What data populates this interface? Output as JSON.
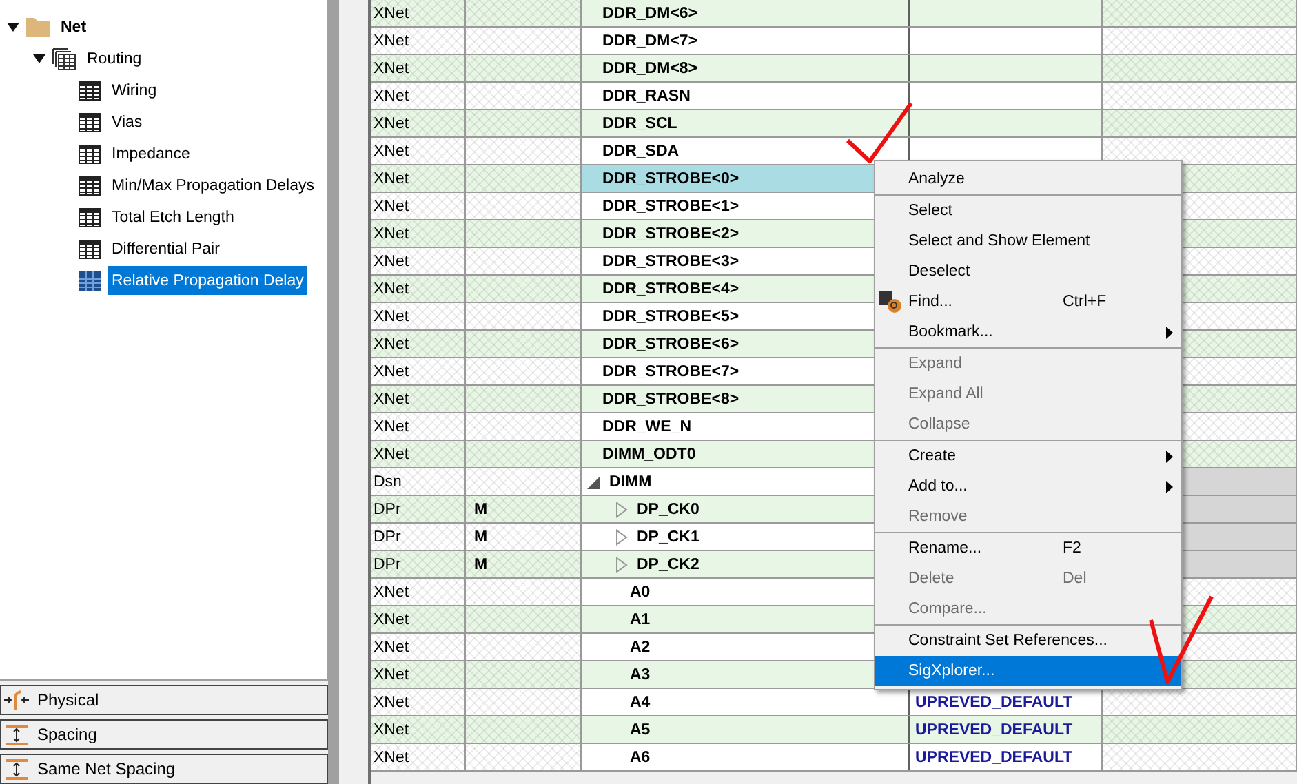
{
  "tree": [
    {
      "label": "Net",
      "expanded": true,
      "kind": "folder",
      "children": [
        {
          "label": "Routing",
          "expanded": true,
          "kind": "group",
          "children": [
            {
              "label": "Wiring",
              "kind": "sheet",
              "selected": false
            },
            {
              "label": "Vias",
              "kind": "sheet",
              "selected": false
            },
            {
              "label": "Impedance",
              "kind": "sheet",
              "selected": false
            },
            {
              "label": "Min/Max Propagation Delays",
              "kind": "sheet",
              "selected": false
            },
            {
              "label": "Total Etch Length",
              "kind": "sheet",
              "selected": false
            },
            {
              "label": "Differential Pair",
              "kind": "sheet",
              "selected": false
            },
            {
              "label": "Relative Propagation Delay",
              "kind": "sheet",
              "selected": true
            }
          ]
        }
      ]
    }
  ],
  "domains": [
    {
      "label": "Physical",
      "kind": "physical"
    },
    {
      "label": "Spacing",
      "kind": "spacing"
    },
    {
      "label": "Same Net Spacing",
      "kind": "spacing"
    }
  ],
  "table": {
    "rows": [
      {
        "column_1": "XNet",
        "column_3": "DDR_DM<6>",
        "selected": false
      },
      {
        "column_1": "XNet",
        "column_3": "DDR_DM<7>",
        "selected": false
      },
      {
        "column_1": "XNet",
        "column_3": "DDR_DM<8>",
        "selected": false
      },
      {
        "column_1": "XNet",
        "column_3": "DDR_RASN",
        "selected": false
      },
      {
        "column_1": "XNet",
        "column_3": "DDR_SCL",
        "selected": false
      },
      {
        "column_1": "XNet",
        "column_3": "DDR_SDA",
        "selected": false
      },
      {
        "column_1": "XNet",
        "column_3": "DDR_STROBE<0>",
        "selected": true
      },
      {
        "column_1": "XNet",
        "column_3": "DDR_STROBE<1>",
        "selected": false
      },
      {
        "column_1": "XNet",
        "column_3": "DDR_STROBE<2>",
        "selected": false
      },
      {
        "column_1": "XNet",
        "column_3": "DDR_STROBE<3>",
        "selected": false
      },
      {
        "column_1": "XNet",
        "column_3": "DDR_STROBE<4>",
        "selected": false
      },
      {
        "column_1": "XNet",
        "column_3": "DDR_STROBE<5>",
        "selected": false
      },
      {
        "column_1": "XNet",
        "column_3": "DDR_STROBE<6>",
        "selected": false
      },
      {
        "column_1": "XNet",
        "column_3": "DDR_STROBE<7>",
        "selected": false
      },
      {
        "column_1": "XNet",
        "column_3": "DDR_STROBE<8>",
        "selected": false
      },
      {
        "column_1": "XNet",
        "column_3": "DDR_WE_N",
        "selected": false
      },
      {
        "column_1": "XNet",
        "column_3": "DIMM_ODT0",
        "selected": false
      },
      {
        "column_1": "Dsn",
        "column_3": "DIMM",
        "selected": false,
        "expanded": true,
        "children": [
          {
            "column_1": "DPr",
            "column_2": "M",
            "column_3": "DP_CK0",
            "selected": false,
            "expanded": false
          },
          {
            "column_1": "DPr",
            "column_2": "M",
            "column_3": "DP_CK1",
            "selected": false,
            "expanded": false
          },
          {
            "column_1": "DPr",
            "column_2": "M",
            "column_3": "DP_CK2",
            "selected": false,
            "expanded": false
          },
          {
            "column_1": "XNet",
            "column_3": "A0",
            "selected": false
          },
          {
            "column_1": "XNet",
            "column_3": "A1",
            "selected": false
          },
          {
            "column_1": "XNet",
            "column_3": "A2",
            "selected": false
          },
          {
            "column_1": "XNet",
            "column_3": "A3",
            "selected": false
          },
          {
            "column_1": "XNet",
            "column_3": "A4",
            "column_4": "UPREVED_DEFAULT",
            "selected": false
          },
          {
            "column_1": "XNet",
            "column_3": "A5",
            "column_4": "UPREVED_DEFAULT",
            "selected": false
          },
          {
            "column_1": "XNet",
            "column_3": "A6",
            "column_4": "UPREVED_DEFAULT",
            "selected": false
          }
        ]
      }
    ]
  },
  "context_menu": [
    {
      "kind": "item",
      "label": "Analyze",
      "disabled": false,
      "highlighted": false
    },
    {
      "kind": "separator"
    },
    {
      "kind": "item",
      "label": "Select",
      "disabled": false,
      "highlighted": false
    },
    {
      "kind": "item",
      "label": "Select and Show Element",
      "disabled": false,
      "highlighted": false
    },
    {
      "kind": "item",
      "label": "Deselect",
      "disabled": false,
      "highlighted": false
    },
    {
      "kind": "item",
      "label": "Find...",
      "shortcut": "Ctrl+F",
      "icon": true,
      "disabled": false,
      "highlighted": false
    },
    {
      "kind": "item",
      "label": "Bookmark...",
      "submenu": true,
      "disabled": false,
      "highlighted": false
    },
    {
      "kind": "separator"
    },
    {
      "kind": "item",
      "label": "Expand",
      "disabled": true,
      "highlighted": false
    },
    {
      "kind": "item",
      "label": "Expand All",
      "disabled": true,
      "highlighted": false
    },
    {
      "kind": "item",
      "label": "Collapse",
      "disabled": true,
      "highlighted": false
    },
    {
      "kind": "separator"
    },
    {
      "kind": "item",
      "label": "Create",
      "submenu": true,
      "disabled": false,
      "highlighted": false
    },
    {
      "kind": "item",
      "label": "Add to...",
      "submenu": true,
      "disabled": false,
      "highlighted": false
    },
    {
      "kind": "item",
      "label": "Remove",
      "disabled": true,
      "highlighted": false
    },
    {
      "kind": "separator"
    },
    {
      "kind": "item",
      "label": "Rename...",
      "shortcut": "F2",
      "disabled": false,
      "highlighted": false
    },
    {
      "kind": "item",
      "label": "Delete",
      "shortcut": "Del",
      "disabled": true,
      "highlighted": false
    },
    {
      "kind": "item",
      "label": "Compare...",
      "disabled": true,
      "highlighted": false
    },
    {
      "kind": "separator"
    },
    {
      "kind": "item",
      "label": "Constraint Set References...",
      "disabled": false,
      "highlighted": false
    },
    {
      "kind": "item",
      "label": "SigXplorer...",
      "disabled": false,
      "highlighted": true
    }
  ]
}
